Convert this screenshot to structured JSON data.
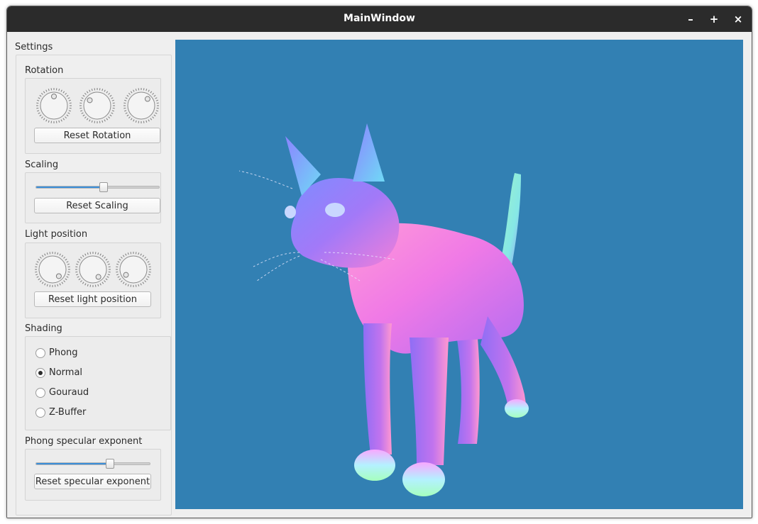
{
  "window": {
    "title": "MainWindow",
    "minimize": "–",
    "maximize": "+",
    "close": "×"
  },
  "settings": {
    "title": "Settings",
    "rotation": {
      "label": "Rotation",
      "dials": [
        0.5,
        0.35,
        0.62
      ],
      "reset": "Reset Rotation"
    },
    "scaling": {
      "label": "Scaling",
      "value": 0.55,
      "reset": "Reset Scaling"
    },
    "light": {
      "label": "Light position",
      "dials": [
        0.88,
        0.9,
        0.15
      ],
      "reset": "Reset light position"
    },
    "shading": {
      "label": "Shading",
      "options": [
        "Phong",
        "Normal",
        "Gouraud",
        "Z-Buffer"
      ],
      "selected": "Normal"
    },
    "specular": {
      "label": "Phong specular exponent",
      "value": 0.65,
      "reset": "Reset specular exponent"
    }
  },
  "viewport": {
    "background": "#3280b3",
    "model": "cat-model"
  },
  "colors": {
    "accent": "#3b8ed8",
    "titlebar": "#2b2b2b"
  }
}
